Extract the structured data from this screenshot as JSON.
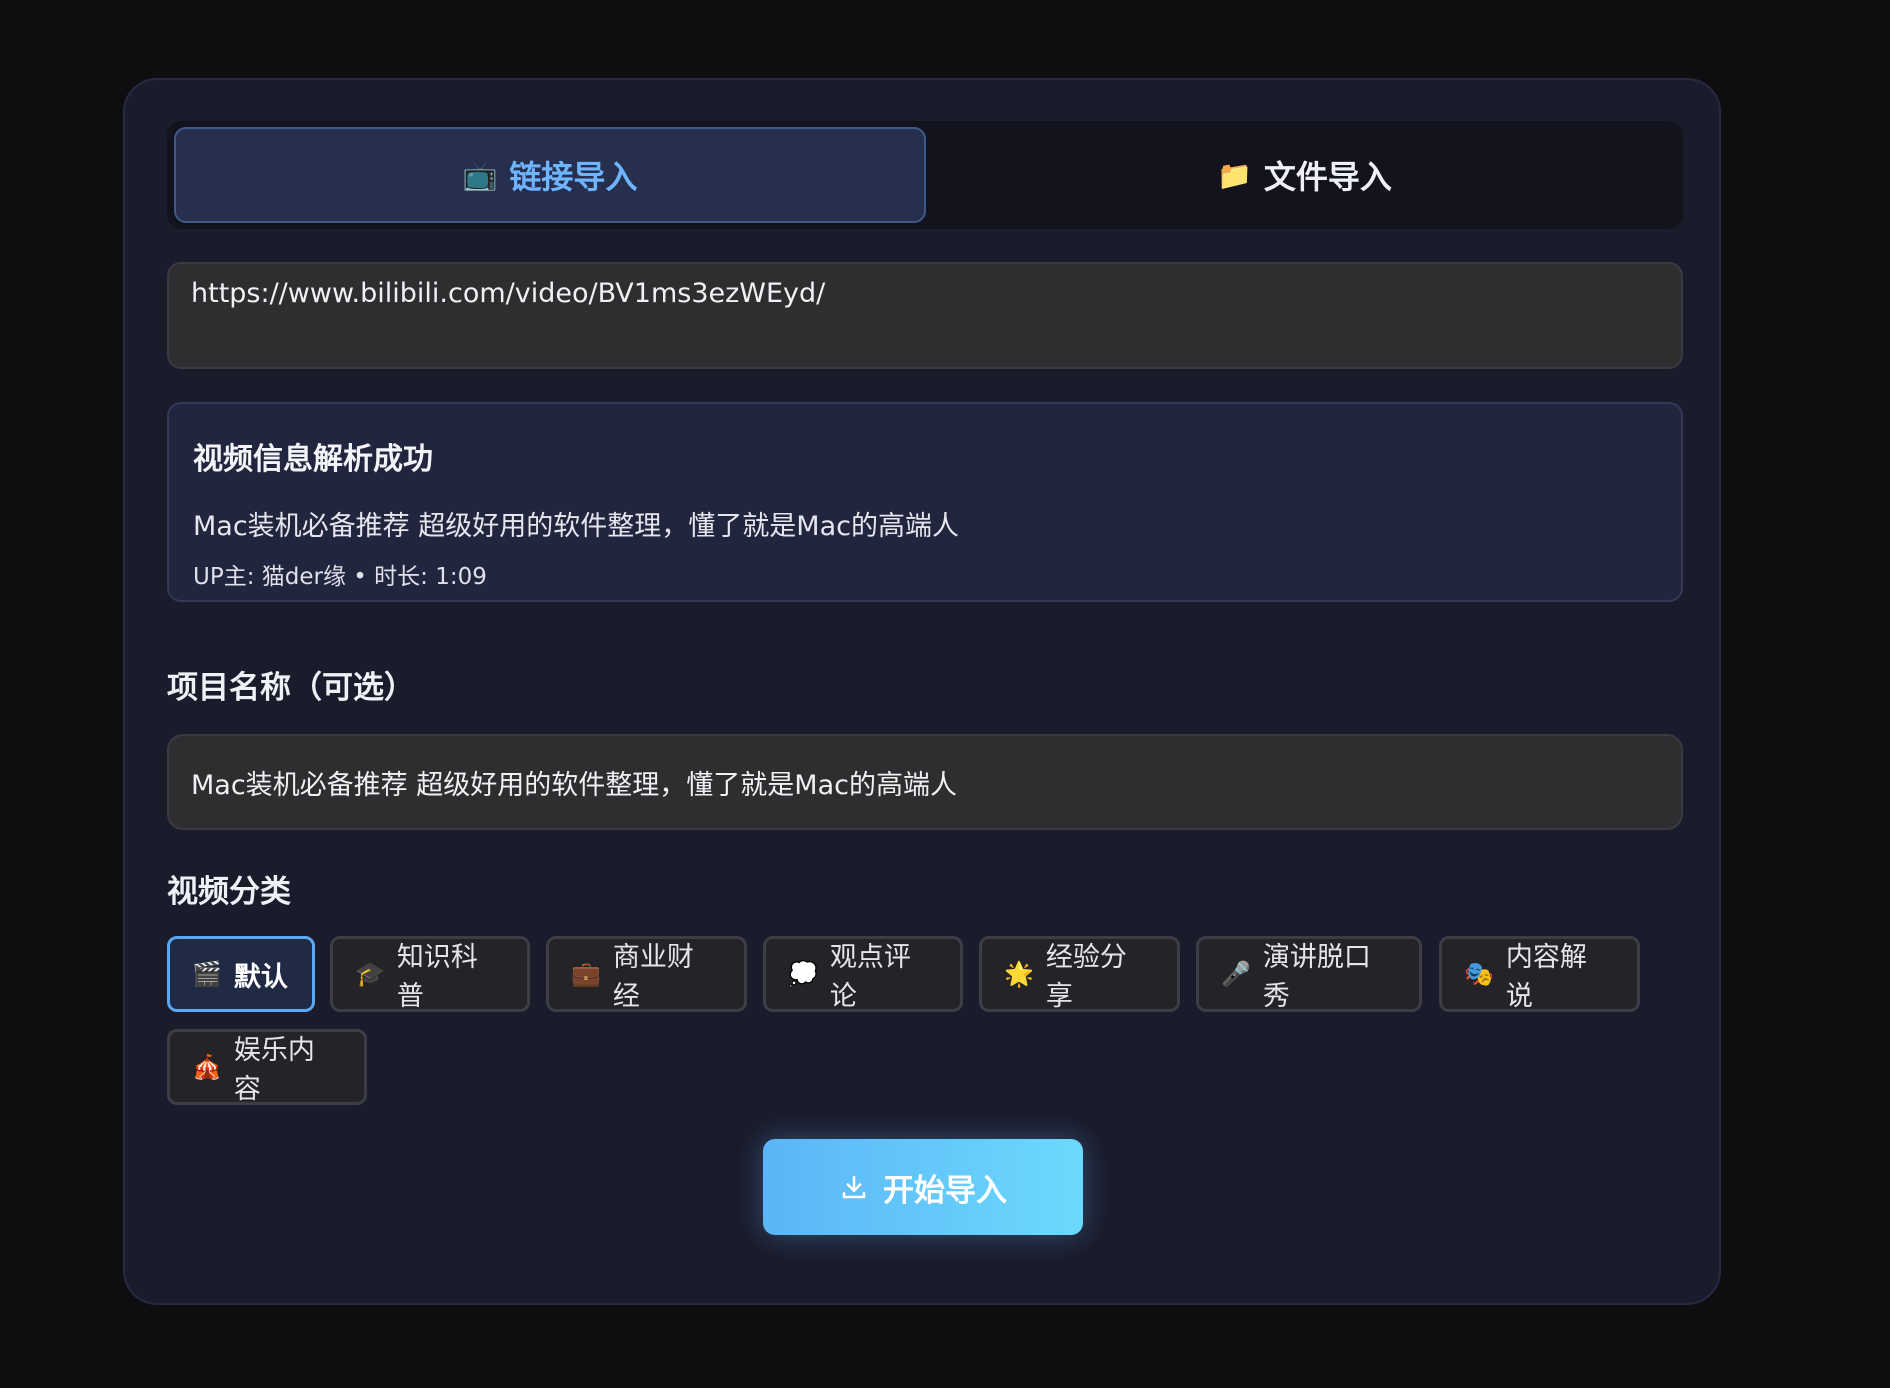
{
  "tabs": [
    {
      "label": "链接导入",
      "icon": "📺",
      "active": true
    },
    {
      "label": "文件导入",
      "icon": "📁",
      "active": false
    }
  ],
  "url_input": {
    "value": "https://www.bilibili.com/video/BV1ms3ezWEyd/"
  },
  "info": {
    "title": "视频信息解析成功",
    "video_title": "Mac装机必备推荐 超级好用的软件整理，懂了就是Mac的高端人",
    "meta": "UP主: 猫der缘 • 时长: 1:09"
  },
  "project_name": {
    "label": "项目名称（可选）",
    "value": "Mac装机必备推荐 超级好用的软件整理，懂了就是Mac的高端人"
  },
  "category": {
    "label": "视频分类",
    "selected": "默认",
    "options": [
      {
        "label": "默认",
        "icon": "🎬"
      },
      {
        "label": "知识科普",
        "icon": "🎓"
      },
      {
        "label": "商业财经",
        "icon": "💼"
      },
      {
        "label": "观点评论",
        "icon": "💭"
      },
      {
        "label": "经验分享",
        "icon": "🌟"
      },
      {
        "label": "演讲脱口秀",
        "icon": "🎤"
      },
      {
        "label": "内容解说",
        "icon": "🎭"
      },
      {
        "label": "娱乐内容",
        "icon": "🎪"
      }
    ]
  },
  "import_button": {
    "label": "开始导入",
    "icon": "download-icon"
  },
  "colors": {
    "accent": "#6fb4ff",
    "button_gradient_start": "#5cb5f6",
    "button_gradient_end": "#6bd9fd",
    "panel_bg": "#1a1b2b"
  }
}
